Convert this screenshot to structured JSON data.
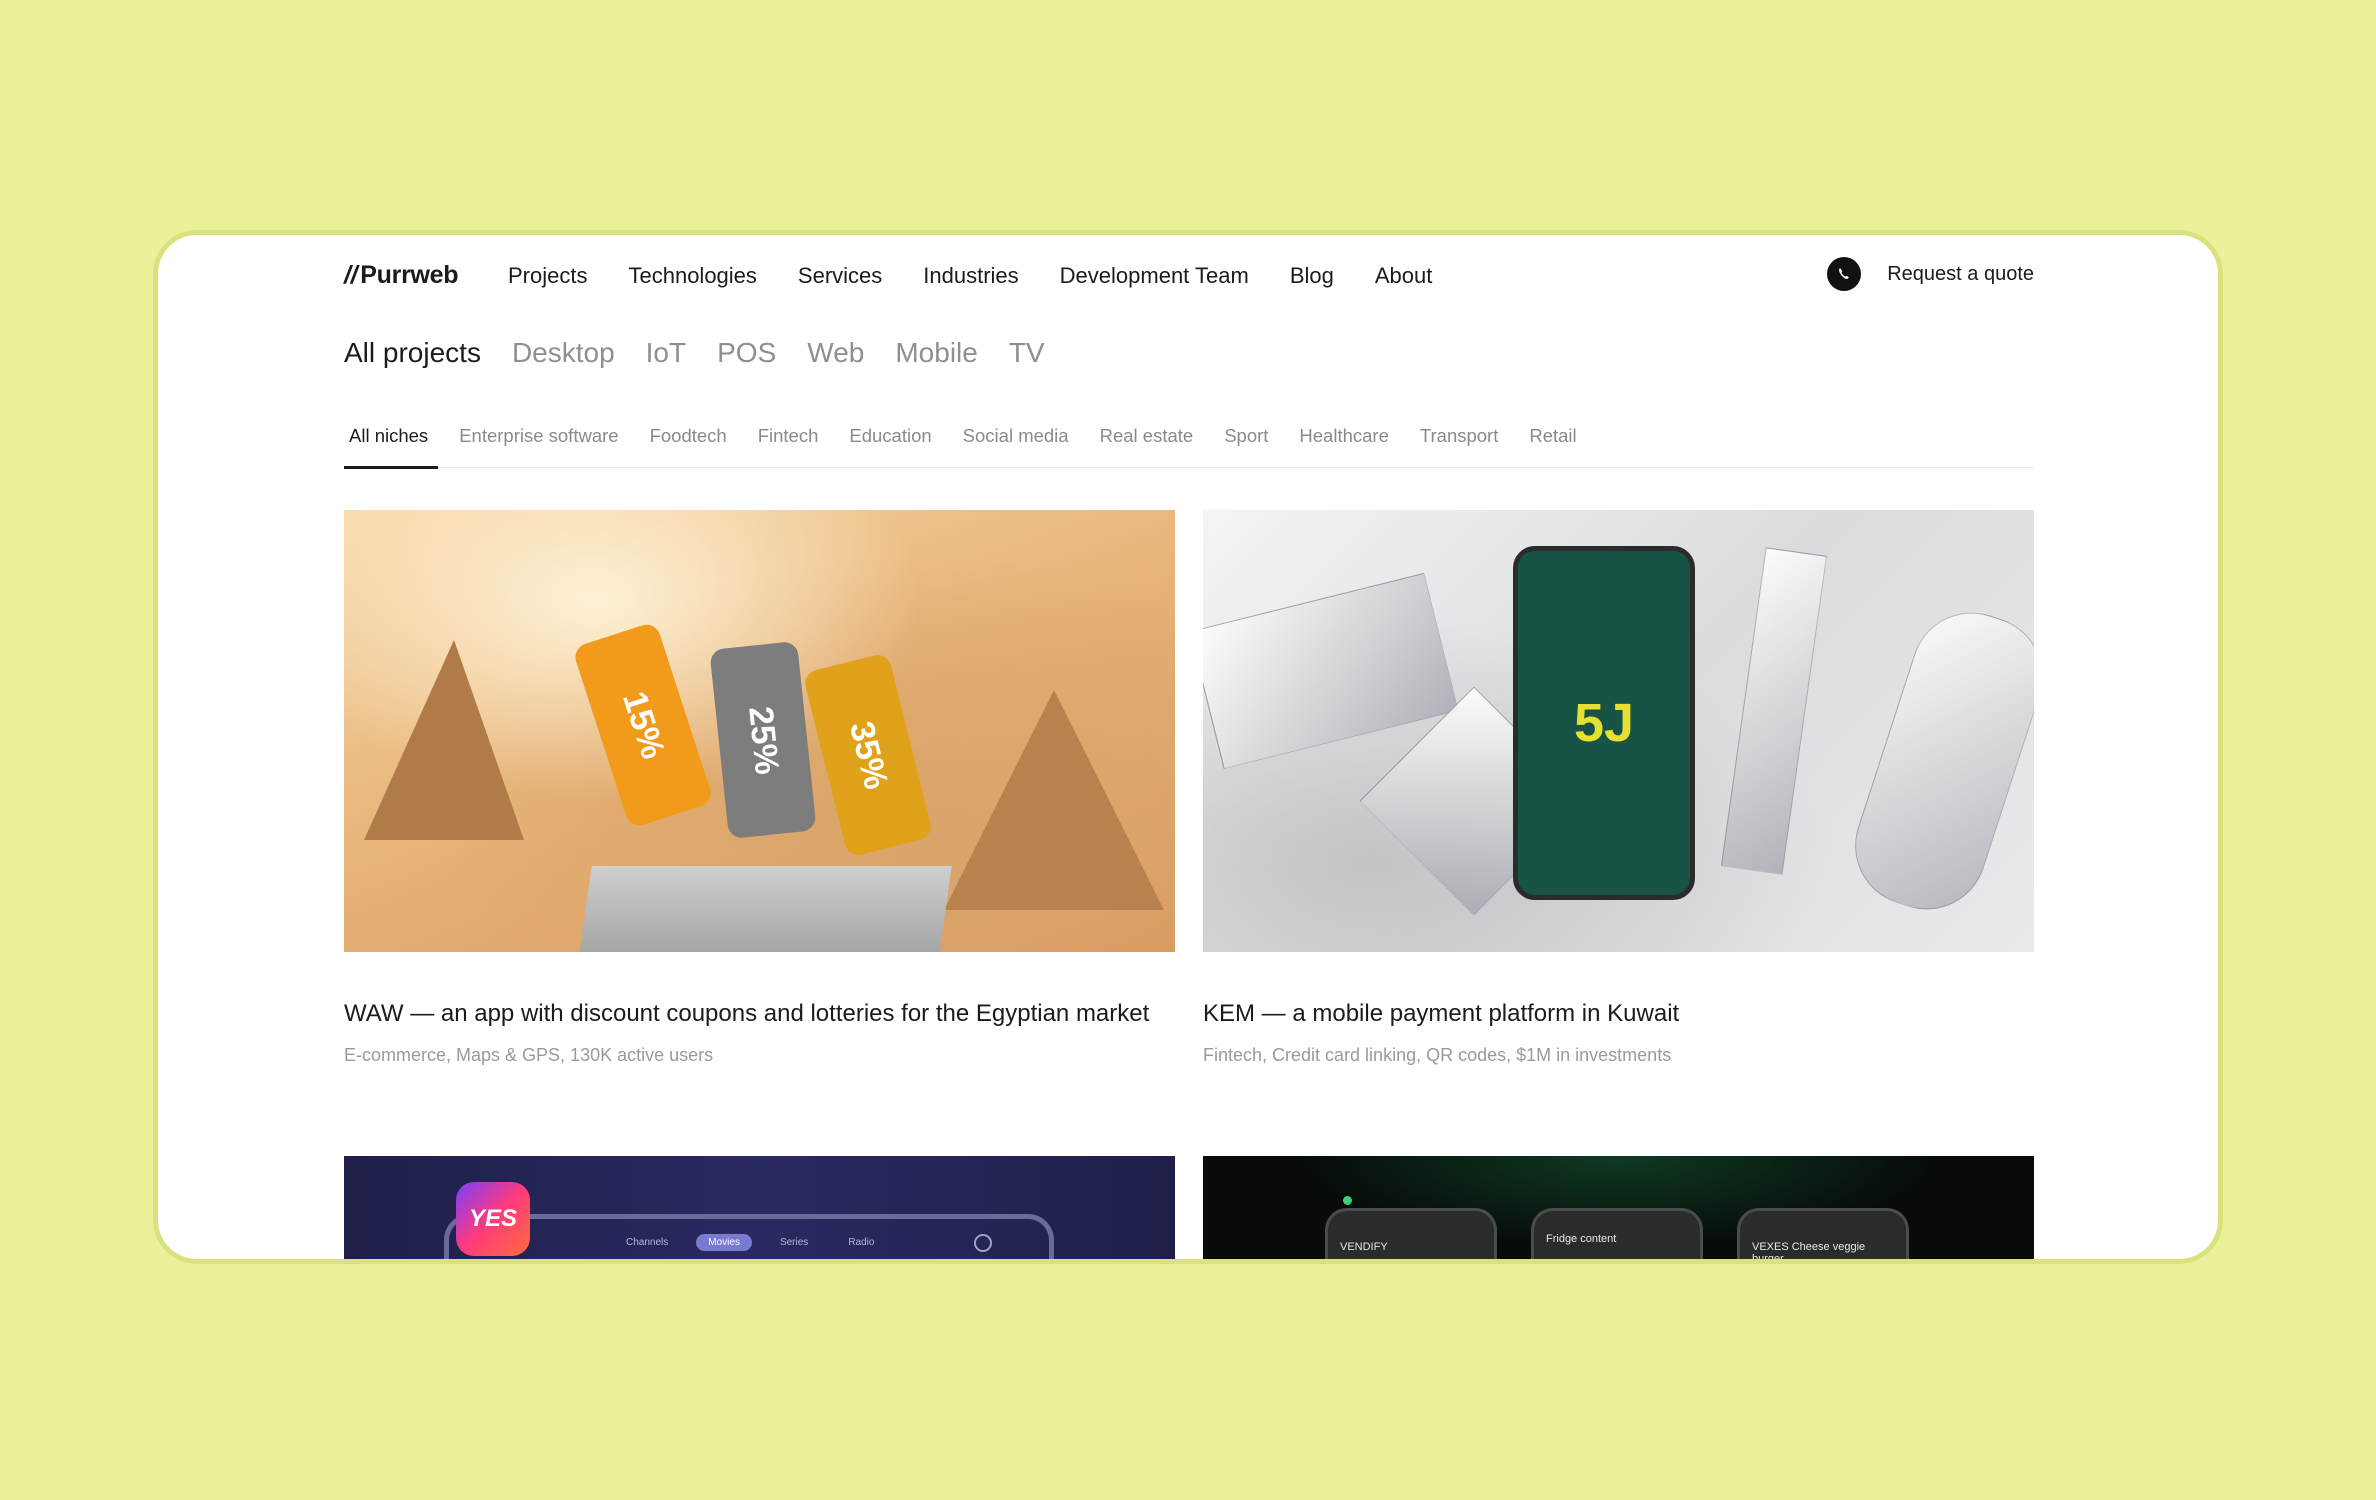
{
  "header": {
    "logo_slashes": "//",
    "logo_text": "Purrweb",
    "nav": [
      "Projects",
      "Technologies",
      "Services",
      "Industries",
      "Development Team",
      "Blog",
      "About"
    ],
    "quote_label": "Request a quote",
    "icon_messenger": "whatsapp-icon"
  },
  "platform_tabs": [
    "All projects",
    "Desktop",
    "IoT",
    "POS",
    "Web",
    "Mobile",
    "TV"
  ],
  "platform_active": "All projects",
  "niche_tabs": [
    "All niches",
    "Enterprise software",
    "Foodtech",
    "Fintech",
    "Education",
    "Social media",
    "Real estate",
    "Sport",
    "Healthcare",
    "Transport",
    "Retail"
  ],
  "niche_active": "All niches",
  "projects": [
    {
      "title": "WAW — an app with discount coupons and lotteries for the Egyptian market",
      "tags": "E-commerce, Maps & GPS, 130K active users",
      "coupons": [
        "15%",
        "25%",
        "35%"
      ]
    },
    {
      "title": "KEM — a mobile payment platform in Kuwait",
      "tags": "Fintech, Credit card linking, QR codes, $1M in investments",
      "phone_mark": "5J"
    },
    {
      "title": "",
      "tags": "",
      "logo_text": "YES",
      "menu": [
        "Channels",
        "Movies",
        "Series",
        "Radio"
      ],
      "menu_active": "Movies"
    },
    {
      "title": "",
      "tags": "",
      "screens": [
        "VENDIFY",
        "Fridge content",
        "VEXES Cheese veggie burger"
      ]
    }
  ],
  "colors": {
    "page_bg": "#ebf09a",
    "frame_border": "#d9e27e",
    "text": "#1b1b1b",
    "muted": "#8f8f8f"
  }
}
